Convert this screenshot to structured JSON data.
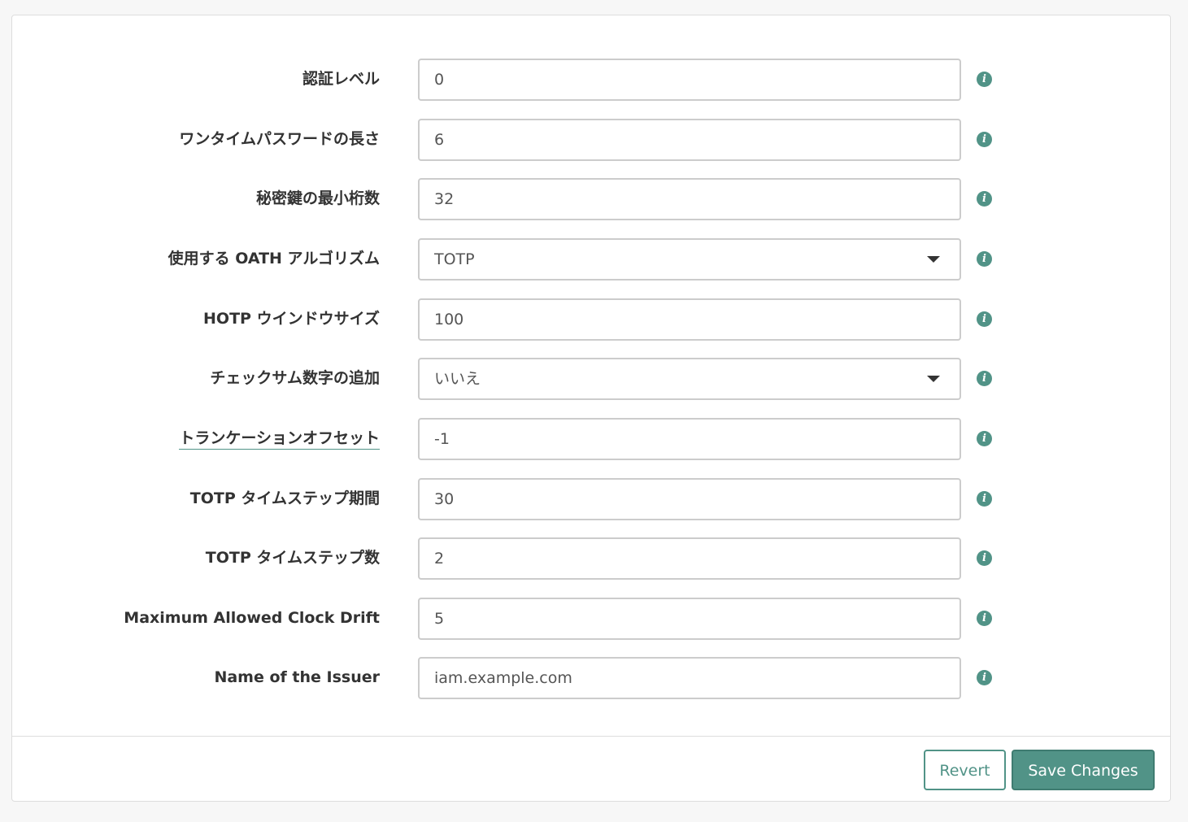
{
  "form": {
    "rows": [
      {
        "label": "認証レベル",
        "value": "0",
        "type": "text"
      },
      {
        "label": "ワンタイムパスワードの長さ",
        "value": "6",
        "type": "text"
      },
      {
        "label": "秘密鍵の最小桁数",
        "value": "32",
        "type": "text"
      },
      {
        "label": "使用する OATH アルゴリズム",
        "value": "TOTP",
        "type": "select"
      },
      {
        "label": "HOTP ウインドウサイズ",
        "value": "100",
        "type": "text"
      },
      {
        "label": "チェックサム数字の追加",
        "value": "いいえ",
        "type": "select"
      },
      {
        "label": "トランケーションオフセット",
        "value": "-1",
        "type": "text"
      },
      {
        "label": "TOTP タイムステップ期間",
        "value": "30",
        "type": "text"
      },
      {
        "label": "TOTP タイムステップ数",
        "value": "2",
        "type": "text"
      },
      {
        "label": "Maximum Allowed Clock Drift",
        "value": "5",
        "type": "text"
      },
      {
        "label": "Name of the Issuer",
        "value": "iam.example.com",
        "type": "text"
      }
    ],
    "info_icon": "info-icon",
    "info_glyph": "i"
  },
  "footer": {
    "revert_label": "Revert",
    "save_label": "Save Changes"
  },
  "colors": {
    "accent": "#519387",
    "border": "#cccccc",
    "label_text": "#333333",
    "input_text": "#555555"
  }
}
